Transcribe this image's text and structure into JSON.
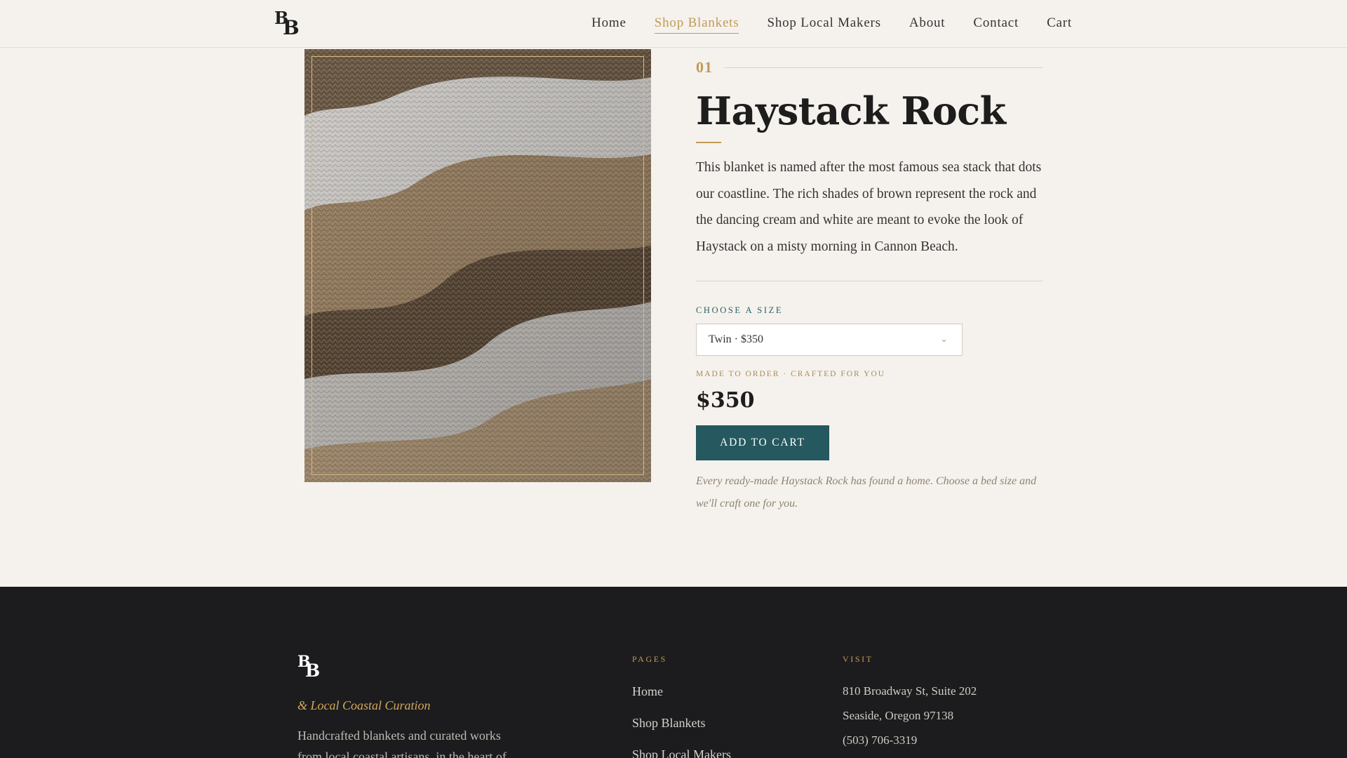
{
  "header": {
    "logo": {
      "top": "B",
      "bottom": "B"
    },
    "nav": [
      {
        "label": "Home"
      },
      {
        "label": "Shop Blankets"
      },
      {
        "label": "Shop Local Makers"
      },
      {
        "label": "About"
      },
      {
        "label": "Contact"
      },
      {
        "label": "Cart"
      }
    ],
    "active_nav": "Shop Blankets"
  },
  "product": {
    "index": "01",
    "title": "Haystack Rock",
    "description": "This blanket is named after the most famous sea stack that dots our coastline. The rich shades of brown represent the rock and the dancing cream and white are meant to evoke the look of Haystack on a misty morning in Cannon Beach.",
    "size_label": "CHOOSE A SIZE",
    "selected_size": "Twin · $350",
    "made_to_order": "MADE TO ORDER · CRAFTED FOR YOU",
    "price": "$350",
    "add_to_cart": "ADD TO CART",
    "note": "Every ready-made Haystack Rock has found a home. Choose a bed size and we'll craft one for you."
  },
  "footer": {
    "logo": {
      "top": "B",
      "bottom": "B"
    },
    "tagline": "& Local Coastal Curation",
    "description": "Handcrafted blankets and curated works from local coastal artisans, in the heart of",
    "pages_heading": "PAGES",
    "pages": [
      {
        "label": "Home"
      },
      {
        "label": "Shop Blankets"
      },
      {
        "label": "Shop Local Makers"
      }
    ],
    "visit_heading": "VISIT",
    "visit": [
      {
        "label": "810 Broadway St, Suite 202"
      },
      {
        "label": "Seaside, Oregon 97138"
      },
      {
        "label": "(503) 706-3319"
      }
    ]
  },
  "colors": {
    "background": "#f5f2ed",
    "accent_gold": "#c29a57",
    "button_teal": "#26585f",
    "footer_bg": "#1c1c1e"
  },
  "icons": {
    "size_dropdown": "chevron-down-icon"
  }
}
